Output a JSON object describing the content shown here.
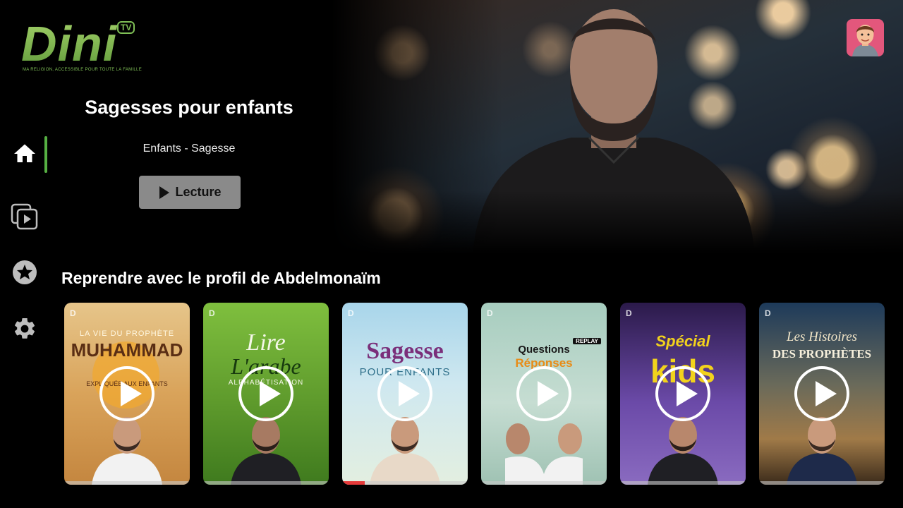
{
  "brand": {
    "logo_text": "Dini",
    "logo_badge": "TV",
    "tagline": "MA RELIGION, ACCESSIBLE POUR TOUTE LA FAMILLE"
  },
  "hero": {
    "title": "Sagesses pour enfants",
    "subtitle": "Enfants - Sagesse",
    "play_label": "Lecture"
  },
  "sidebar": {
    "items": [
      {
        "name": "home",
        "icon": "home-icon",
        "active": true
      },
      {
        "name": "library",
        "icon": "library-play-icon",
        "active": false
      },
      {
        "name": "favorites",
        "icon": "star-icon",
        "active": false
      },
      {
        "name": "settings",
        "icon": "gear-icon",
        "active": false
      }
    ],
    "accent": "#56b043"
  },
  "continue_row": {
    "title": "Reprendre avec le profil de Abdelmonaïm",
    "items": [
      {
        "brand": "D",
        "title_top": "LA VIE DU PROPHÈTE",
        "title_main": "MUHAMMAD",
        "title_sub": "EXPLIQUÉE AUX ENFANTS",
        "progress": 0
      },
      {
        "brand": "D",
        "title_top": "Lire",
        "title_main": "L'arabe",
        "title_sub": "ALPHABÉTISATION",
        "progress": 0
      },
      {
        "brand": "D",
        "title_top": "Sagesse",
        "title_main": "POUR ENFANTS",
        "title_sub": "",
        "progress": 0.18
      },
      {
        "brand": "D",
        "title_top": "Questions",
        "title_main": "Réponses",
        "title_sub": "REPLAY",
        "progress": 0
      },
      {
        "brand": "D",
        "title_top": "Spécial",
        "title_main": "kids",
        "title_sub": "",
        "progress": 0
      },
      {
        "brand": "D",
        "title_top": "Les Histoires",
        "title_main": "DES PROPHÈTES",
        "title_sub": "",
        "progress": 0
      }
    ]
  }
}
